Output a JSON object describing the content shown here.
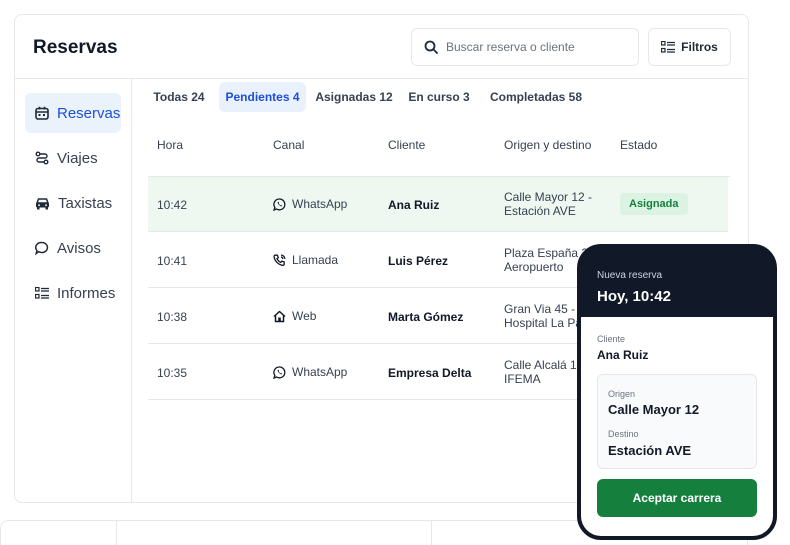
{
  "header": {
    "title": "Reservas",
    "search_placeholder": "Buscar reserva o cliente",
    "filter_label": "Filtros"
  },
  "sidebar": {
    "items": [
      {
        "label": "Reservas",
        "icon": "calendar-icon",
        "active": true
      },
      {
        "label": "Viajes",
        "icon": "route-icon",
        "active": false
      },
      {
        "label": "Taxistas",
        "icon": "car-icon",
        "active": false
      },
      {
        "label": "Avisos",
        "icon": "message-icon",
        "active": false
      },
      {
        "label": "Informes",
        "icon": "report-icon",
        "active": false
      }
    ]
  },
  "tabs": [
    {
      "label": "Todas 24",
      "active": false
    },
    {
      "label": "Pendientes 4",
      "active": true
    },
    {
      "label": "Asignadas 12",
      "active": false
    },
    {
      "label": "En curso 3",
      "active": false
    },
    {
      "label": "Completadas 58",
      "active": false
    }
  ],
  "table": {
    "columns": [
      "Hora",
      "Canal",
      "Cliente",
      "Origen y destino",
      "Estado"
    ],
    "rows": [
      {
        "time": "10:42",
        "channel": "WhatsApp",
        "channel_icon": "whatsapp-icon",
        "client": "Ana Ruiz",
        "route_line1": "Calle Mayor 12 -",
        "route_line2": "Estación AVE",
        "status": "Asignada",
        "highlight": true
      },
      {
        "time": "10:41",
        "channel": "Llamada",
        "channel_icon": "phone-icon",
        "client": "Luis Pérez",
        "route_line1": "Plaza España 3",
        "route_line2": "Aeropuerto",
        "status": "",
        "highlight": false
      },
      {
        "time": "10:38",
        "channel": "Web",
        "channel_icon": "home-icon",
        "client": "Marta Gómez",
        "route_line1": "Gran Via 45 -",
        "route_line2": "Hospital La Pa",
        "status": "",
        "highlight": false
      },
      {
        "time": "10:35",
        "channel": "WhatsApp",
        "channel_icon": "whatsapp-icon",
        "client": "Empresa Delta",
        "route_line1": "Calle Alcalá 10",
        "route_line2": "IFEMA",
        "status": "",
        "highlight": false
      }
    ]
  },
  "phone": {
    "subtitle": "Nueva reserva",
    "title": "Hoy, 10:42",
    "client_label": "Cliente",
    "client_value": "Ana Ruiz",
    "origin_label": "Origen",
    "origin_value": "Calle Mayor 12",
    "destination_label": "Destino",
    "destination_value": "Estación AVE",
    "accept_label": "Aceptar carrera"
  },
  "colors": {
    "accent": "#1d4ed8",
    "success": "#15803d",
    "dark": "#111827"
  }
}
